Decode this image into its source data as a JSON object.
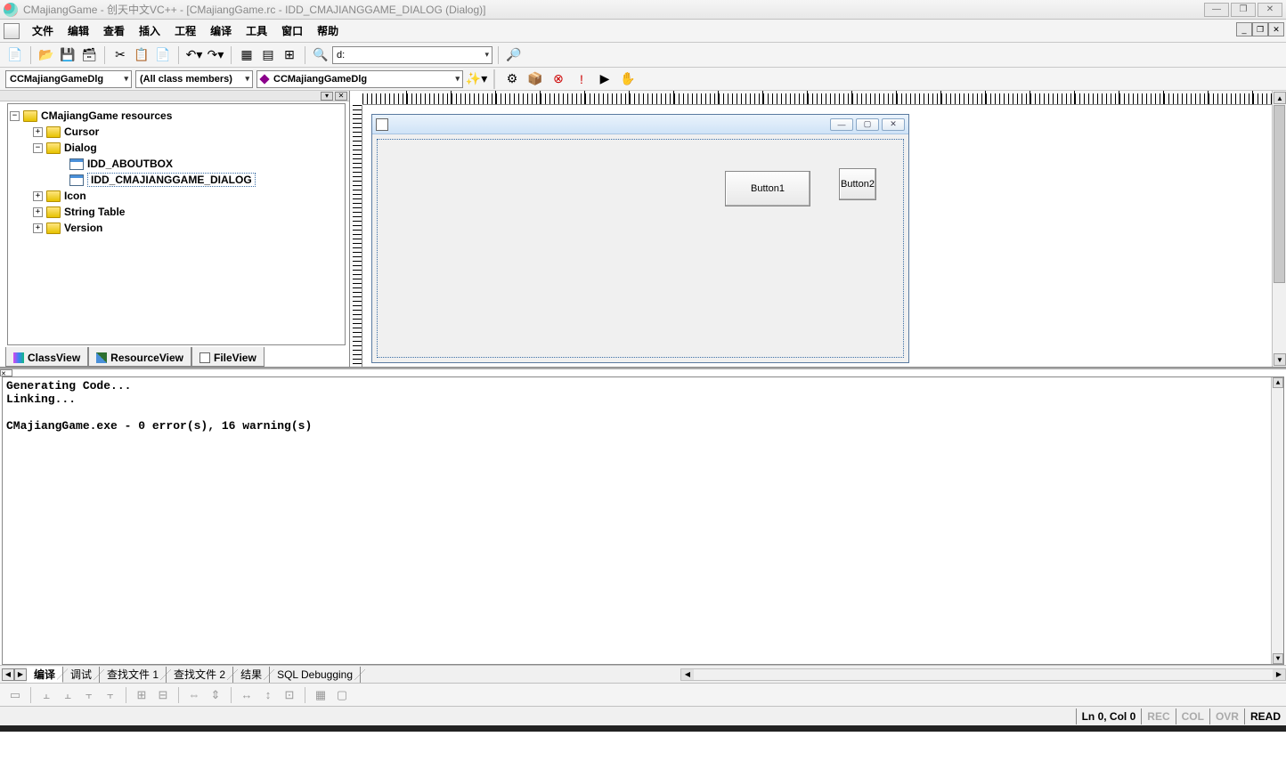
{
  "window": {
    "title": "CMajiangGame - 创天中文VC++ - [CMajiangGame.rc - IDD_CMAJIANGGAME_DIALOG (Dialog)]"
  },
  "menu": {
    "items": [
      "文件",
      "编辑",
      "查看",
      "插入",
      "工程",
      "编译",
      "工具",
      "窗口",
      "帮助"
    ]
  },
  "toolbar1": {
    "path_combo": "d:"
  },
  "classbar": {
    "class_combo": "CCMajiangGameDlg",
    "members_combo": "(All class members)",
    "func_combo": "CCMajiangGameDlg"
  },
  "tree": {
    "root": "CMajiangGame resources",
    "cursor": "Cursor",
    "dialog": "Dialog",
    "dlg_about": "IDD_ABOUTBOX",
    "dlg_main": "IDD_CMAJIANGGAME_DIALOG",
    "icon": "Icon",
    "stringtable": "String Table",
    "version": "Version"
  },
  "panel_tabs": {
    "classview": "ClassView",
    "resourceview": "ResourceView",
    "fileview": "FileView"
  },
  "designer": {
    "button1": "Button1",
    "button2": "Button2"
  },
  "output": {
    "line1": "Generating Code...",
    "line2": "Linking...",
    "line3": "",
    "line4": "CMajiangGame.exe - 0 error(s), 16 warning(s)"
  },
  "output_tabs": {
    "compile": "编译",
    "debug": "调试",
    "find1": "查找文件 1",
    "find2": "查找文件 2",
    "results": "结果",
    "sql": "SQL Debugging"
  },
  "status": {
    "pos": "Ln 0, Col 0",
    "rec": "REC",
    "col": "COL",
    "ovr": "OVR",
    "read": "READ"
  }
}
